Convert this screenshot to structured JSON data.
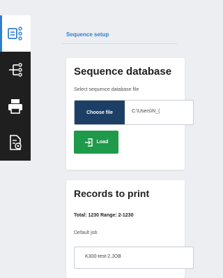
{
  "sidebar": {
    "items": [
      {
        "icon": "sequence-list-icon",
        "active": true
      },
      {
        "icon": "tree-structure-icon",
        "active": false
      },
      {
        "icon": "printer-icon",
        "active": false
      },
      {
        "icon": "document-settings-icon",
        "active": false
      }
    ]
  },
  "breadcrumb": "Sequence setup",
  "sequence_database": {
    "title": "Sequence database",
    "select_label": "Select sequence database file",
    "choose_file_label": "Choose file",
    "file_path": "C:\\Users\\N_(",
    "load_label": "Load"
  },
  "records": {
    "title": "Records to print",
    "summary": "Total: 1230 Range: 2-1230",
    "default_job_label": "Default job",
    "default_job_value": "K300-test-2.JOB"
  },
  "colors": {
    "accent": "#2f7fcf",
    "sidebar_bg": "#1f1f1f",
    "primary_button": "#1d3f66",
    "load_button": "#1f9a4a",
    "page_bg": "#eceef1"
  }
}
